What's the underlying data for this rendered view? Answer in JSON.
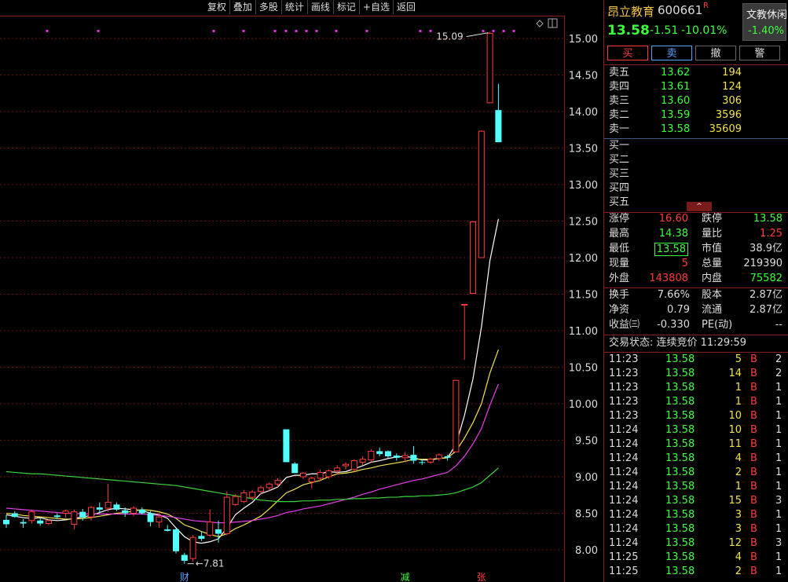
{
  "toolbar": [
    "复权",
    "叠加",
    "多股",
    "统计",
    "画线",
    "标记",
    "+自选",
    "返回"
  ],
  "chart_data": {
    "type": "candlestick",
    "y_axis": {
      "min": 7.8,
      "max": 15.3,
      "ticks": [
        "15.00",
        "14.50",
        "14.00",
        "13.50",
        "13.00",
        "12.50",
        "12.00",
        "11.50",
        "11.00",
        "10.50",
        "10.00",
        "9.50",
        "9.00",
        "8.50",
        "8.00"
      ]
    },
    "candles": [
      [
        8.41,
        8.48,
        8.3,
        8.35
      ],
      [
        8.5,
        8.53,
        8.44,
        8.45
      ],
      [
        8.38,
        8.42,
        8.3,
        8.36
      ],
      [
        8.4,
        8.55,
        8.36,
        8.52
      ],
      [
        8.4,
        8.44,
        8.33,
        8.36
      ],
      [
        8.36,
        8.42,
        8.34,
        8.4
      ],
      [
        8.47,
        8.5,
        8.42,
        8.45
      ],
      [
        8.5,
        8.55,
        8.44,
        8.53
      ],
      [
        8.35,
        8.55,
        8.28,
        8.52
      ],
      [
        8.52,
        8.56,
        8.4,
        8.44
      ],
      [
        8.45,
        8.6,
        8.4,
        8.58
      ],
      [
        8.58,
        8.65,
        8.5,
        8.55
      ],
      [
        8.57,
        8.9,
        8.52,
        8.65
      ],
      [
        8.62,
        8.65,
        8.53,
        8.55
      ],
      [
        8.54,
        8.58,
        8.45,
        8.5
      ],
      [
        8.5,
        8.6,
        8.46,
        8.57
      ],
      [
        8.55,
        8.58,
        8.48,
        8.5
      ],
      [
        8.5,
        8.53,
        8.32,
        8.38
      ],
      [
        8.38,
        8.5,
        8.3,
        8.45
      ],
      [
        8.28,
        8.34,
        8.25,
        8.26
      ],
      [
        8.28,
        8.3,
        7.95,
        7.98
      ],
      [
        7.93,
        7.96,
        7.81,
        7.85
      ],
      [
        7.88,
        8.2,
        7.84,
        8.17
      ],
      [
        8.19,
        8.25,
        8.12,
        8.15
      ],
      [
        8.2,
        8.55,
        8.18,
        8.38
      ],
      [
        8.28,
        8.4,
        8.1,
        8.22
      ],
      [
        8.22,
        8.8,
        8.2,
        8.72
      ],
      [
        8.62,
        8.76,
        8.6,
        8.73
      ],
      [
        8.66,
        8.82,
        8.64,
        8.78
      ],
      [
        8.72,
        8.82,
        8.68,
        8.79
      ],
      [
        8.8,
        8.88,
        8.76,
        8.85
      ],
      [
        8.85,
        8.92,
        8.8,
        8.9
      ],
      [
        8.9,
        8.98,
        8.86,
        8.95
      ],
      [
        9.65,
        9.65,
        9.2,
        9.2
      ],
      [
        9.18,
        9.2,
        9.05,
        9.05
      ],
      [
        9.0,
        9.06,
        8.97,
        9.05
      ],
      [
        8.93,
        9.0,
        8.84,
        8.98
      ],
      [
        8.98,
        9.1,
        8.94,
        9.06
      ],
      [
        9.0,
        9.1,
        8.97,
        9.08
      ],
      [
        9.08,
        9.16,
        9.04,
        9.12
      ],
      [
        9.15,
        9.2,
        9.1,
        9.17
      ],
      [
        9.1,
        9.24,
        9.07,
        9.22
      ],
      [
        9.2,
        9.28,
        9.16,
        9.24
      ],
      [
        9.23,
        9.38,
        9.2,
        9.35
      ],
      [
        9.35,
        9.4,
        9.28,
        9.31
      ],
      [
        9.35,
        9.36,
        9.26,
        9.28
      ],
      [
        9.29,
        9.32,
        9.22,
        9.26
      ],
      [
        9.26,
        9.34,
        9.2,
        9.29
      ],
      [
        9.3,
        9.42,
        9.18,
        9.22
      ],
      [
        9.2,
        9.24,
        9.16,
        9.19
      ],
      [
        9.2,
        9.26,
        9.18,
        9.24
      ],
      [
        9.25,
        9.32,
        9.22,
        9.3
      ],
      [
        9.28,
        9.3,
        9.22,
        9.26
      ],
      [
        9.34,
        10.33,
        9.34,
        10.32
      ],
      [
        11.36,
        11.36,
        10.6,
        11.36
      ],
      [
        11.51,
        12.5,
        11.51,
        12.49
      ],
      [
        12.0,
        13.74,
        12.0,
        13.73
      ],
      [
        14.12,
        15.09,
        14.12,
        15.07
      ],
      [
        14.02,
        14.38,
        13.58,
        13.58
      ]
    ],
    "ma_series": [
      {
        "color": "#ffffff",
        "values": [
          8.48,
          8.46,
          8.44,
          8.43,
          8.44,
          8.41,
          8.4,
          8.41,
          8.43,
          8.45,
          8.47,
          8.51,
          8.55,
          8.57,
          8.56,
          8.55,
          8.54,
          8.5,
          8.48,
          8.43,
          8.3,
          8.18,
          8.11,
          8.09,
          8.11,
          8.15,
          8.3,
          8.48,
          8.57,
          8.65,
          8.77,
          8.81,
          8.86,
          8.99,
          9.02,
          9.02,
          9.04,
          9.04,
          9.07,
          9.06,
          9.07,
          9.11,
          9.15,
          9.2,
          9.22,
          9.25,
          9.27,
          9.28,
          9.26,
          9.23,
          9.23,
          9.25,
          9.26,
          9.44,
          9.84,
          10.34,
          11.05,
          11.96,
          12.53
        ]
      },
      {
        "color": "#f2e24e",
        "values": [
          8.5,
          8.49,
          8.47,
          8.46,
          8.45,
          8.44,
          8.43,
          8.42,
          8.42,
          8.43,
          8.44,
          8.46,
          8.48,
          8.5,
          8.51,
          8.53,
          8.55,
          8.54,
          8.52,
          8.49,
          8.43,
          8.34,
          8.3,
          8.25,
          8.21,
          8.18,
          8.22,
          8.29,
          8.34,
          8.4,
          8.46,
          8.56,
          8.67,
          8.78,
          8.83,
          8.89,
          8.92,
          8.95,
          9.0,
          9.04,
          9.05,
          9.07,
          9.1,
          9.12,
          9.15,
          9.17,
          9.19,
          9.21,
          9.24,
          9.24,
          9.24,
          9.25,
          9.26,
          9.35,
          9.53,
          9.74,
          10.0,
          10.42,
          10.74
        ]
      },
      {
        "color": "#e93de9",
        "values": [
          8.57,
          8.56,
          8.55,
          8.54,
          8.53,
          8.52,
          8.51,
          8.5,
          8.5,
          8.49,
          8.49,
          8.49,
          8.49,
          8.49,
          8.49,
          8.49,
          8.49,
          8.48,
          8.47,
          8.46,
          8.44,
          8.42,
          8.4,
          8.39,
          8.38,
          8.37,
          8.37,
          8.38,
          8.39,
          8.4,
          8.42,
          8.44,
          8.47,
          8.51,
          8.53,
          8.56,
          8.58,
          8.6,
          8.63,
          8.66,
          8.69,
          8.72,
          8.76,
          8.79,
          8.83,
          8.86,
          8.89,
          8.92,
          8.95,
          8.97,
          9.0,
          9.03,
          9.06,
          9.15,
          9.28,
          9.45,
          9.66,
          9.98,
          10.27
        ]
      },
      {
        "color": "#3ad23a",
        "values": [
          9.07,
          9.06,
          9.05,
          9.04,
          9.04,
          9.03,
          9.02,
          9.01,
          9.0,
          8.99,
          8.98,
          8.97,
          8.96,
          8.95,
          8.94,
          8.93,
          8.92,
          8.91,
          8.9,
          8.89,
          8.88,
          8.86,
          8.84,
          8.82,
          8.8,
          8.78,
          8.76,
          8.74,
          8.72,
          8.7,
          8.68,
          8.67,
          8.66,
          8.66,
          8.66,
          8.67,
          8.67,
          8.68,
          8.68,
          8.69,
          8.69,
          8.7,
          8.7,
          8.71,
          8.71,
          8.72,
          8.72,
          8.73,
          8.73,
          8.74,
          8.74,
          8.75,
          8.76,
          8.78,
          8.82,
          8.86,
          8.92,
          9.02,
          9.12
        ]
      }
    ],
    "annotations": {
      "high_label": "15.09",
      "low_label": "7.81"
    },
    "markers": [
      {
        "candle": 21,
        "text": "财"
      },
      {
        "candle": 47,
        "text": "减"
      },
      {
        "candle": 56,
        "text": "张"
      }
    ]
  },
  "stock": {
    "name": "昂立教育",
    "code": "600661",
    "flag": "R",
    "price": "13.58",
    "change": "-1.51",
    "pct": "-10.01%",
    "sector_name": "文教休闲",
    "sector_pct": "-1.40%"
  },
  "trade_buttons": [
    "买",
    "卖",
    "撤",
    "警"
  ],
  "asks": [
    {
      "label": "卖五",
      "price": "13.62",
      "vol": "194"
    },
    {
      "label": "卖四",
      "price": "13.61",
      "vol": "124"
    },
    {
      "label": "卖三",
      "price": "13.60",
      "vol": "306"
    },
    {
      "label": "卖二",
      "price": "13.59",
      "vol": "3596"
    },
    {
      "label": "卖一",
      "price": "13.58",
      "vol": "35609"
    }
  ],
  "bids": [
    {
      "label": "买一"
    },
    {
      "label": "买二"
    },
    {
      "label": "买三"
    },
    {
      "label": "买四"
    },
    {
      "label": "买五"
    }
  ],
  "toggle_glyph": "^",
  "quote": {
    "limit_up_label": "涨停",
    "limit_up": "16.60",
    "limit_down_label": "跌停",
    "limit_down": "13.58",
    "high_label": "最高",
    "high": "14.38",
    "vol_ratio_label": "量比",
    "vol_ratio": "1.25",
    "low_label": "最低",
    "low": "13.58",
    "mcap_label": "市值",
    "mcap": "38.9亿",
    "last_vol_label": "现量",
    "last_vol": "5",
    "total_vol_label": "总量",
    "total_vol": "219390",
    "outer_label": "外盘",
    "outer": "143808",
    "inner_label": "内盘",
    "inner": "75582"
  },
  "fundamentals": {
    "turnover_label": "换手",
    "turnover": "7.66%",
    "shares_label": "股本",
    "shares": "2.87亿",
    "nav_label": "净资",
    "nav": "0.79",
    "float_label": "流通",
    "float": "2.87亿",
    "eps_label": "收益㈢",
    "eps": "-0.330",
    "pe_label": "PE(动)",
    "pe": "--"
  },
  "status_line": "交易状态: 连续竞价 11:29:59",
  "ticks": [
    {
      "time": "11:23",
      "price": "13.58",
      "vol": "5",
      "side": "B",
      "n": "2"
    },
    {
      "time": "11:23",
      "price": "13.58",
      "vol": "14",
      "side": "B",
      "n": "2"
    },
    {
      "time": "11:23",
      "price": "13.58",
      "vol": "1",
      "side": "B",
      "n": "1"
    },
    {
      "time": "11:23",
      "price": "13.58",
      "vol": "1",
      "side": "B",
      "n": "1"
    },
    {
      "time": "11:23",
      "price": "13.58",
      "vol": "10",
      "side": "B",
      "n": "1"
    },
    {
      "time": "11:24",
      "price": "13.58",
      "vol": "10",
      "side": "B",
      "n": "1"
    },
    {
      "time": "11:24",
      "price": "13.58",
      "vol": "11",
      "side": "B",
      "n": "1"
    },
    {
      "time": "11:24",
      "price": "13.58",
      "vol": "4",
      "side": "B",
      "n": "1"
    },
    {
      "time": "11:24",
      "price": "13.58",
      "vol": "2",
      "side": "B",
      "n": "1"
    },
    {
      "time": "11:24",
      "price": "13.58",
      "vol": "1",
      "side": "B",
      "n": "1"
    },
    {
      "time": "11:24",
      "price": "13.58",
      "vol": "15",
      "side": "B",
      "n": "3"
    },
    {
      "time": "11:24",
      "price": "13.58",
      "vol": "3",
      "side": "B",
      "n": "1"
    },
    {
      "time": "11:24",
      "price": "13.58",
      "vol": "3",
      "side": "B",
      "n": "1"
    },
    {
      "time": "11:24",
      "price": "13.58",
      "vol": "12",
      "side": "B",
      "n": "3"
    },
    {
      "time": "11:25",
      "price": "13.58",
      "vol": "4",
      "side": "B",
      "n": "1"
    },
    {
      "time": "11:25",
      "price": "13.58",
      "vol": "2",
      "side": "B",
      "n": "1"
    }
  ]
}
